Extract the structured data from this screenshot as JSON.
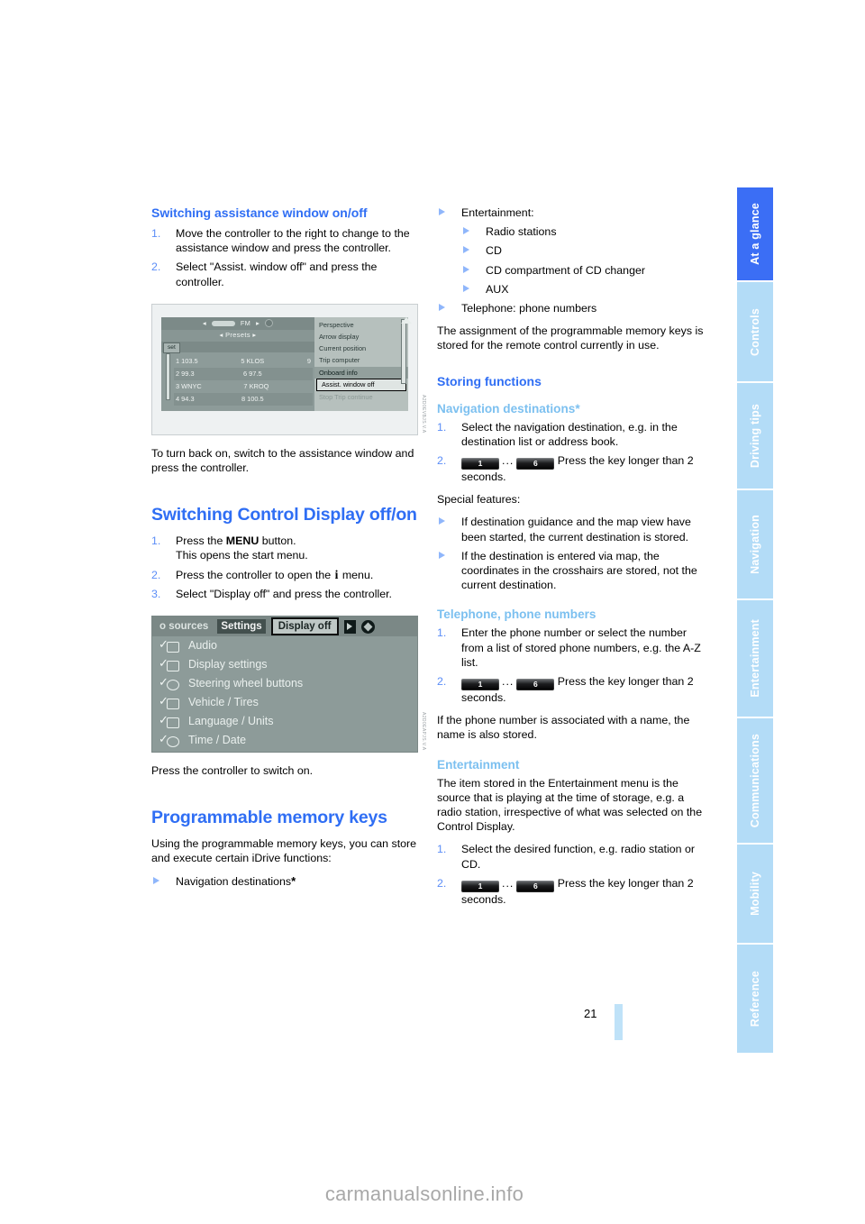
{
  "page_number": "21",
  "watermark": "carmanualsonline.info",
  "colors": {
    "heading_blue": "#2f6ef4",
    "subheading_light_blue": "#7cc0f0",
    "tab_active": "#3b6ef5",
    "tab_inactive": "#b3dcf7",
    "page_bar": "#bfe2f8"
  },
  "side_tabs": [
    {
      "label": "At a glance",
      "active": true
    },
    {
      "label": "Controls",
      "active": false
    },
    {
      "label": "Driving tips",
      "active": false
    },
    {
      "label": "Navigation",
      "active": false
    },
    {
      "label": "Entertainment",
      "active": false
    },
    {
      "label": "Communications",
      "active": false
    },
    {
      "label": "Mobility",
      "active": false
    },
    {
      "label": "Reference",
      "active": false
    }
  ],
  "left_column": {
    "section1": {
      "heading": "Switching assistance window on/off",
      "steps": [
        {
          "num": "1.",
          "text": "Move the controller to the right to change to the assistance window and press the controller."
        },
        {
          "num": "2.",
          "text": "Select \"Assist. window off\" and press the controller."
        }
      ],
      "figure": {
        "ref_code": "A2D0EVBJS.V.A",
        "topbar_label": "FM",
        "presets_label": "Presets",
        "set_button": "set",
        "stations": [
          {
            "left": "1 103.5",
            "mid": "5 KLOS",
            "right": "9"
          },
          {
            "left": "2 99.3",
            "mid": "6 97.5",
            "right": ""
          },
          {
            "left": "3 WNYC",
            "mid": "7 KROQ",
            "right": ""
          },
          {
            "left": "4 94.3",
            "mid": "8 100.5",
            "right": ""
          }
        ],
        "menu_items": [
          {
            "label": "Perspective",
            "state": "normal"
          },
          {
            "label": "Arrow display",
            "state": "normal"
          },
          {
            "label": "Current position",
            "state": "normal"
          },
          {
            "label": "Trip computer",
            "state": "normal"
          },
          {
            "label": "Onboard info",
            "state": "highlight"
          },
          {
            "label": "Assist. window off",
            "state": "selected"
          },
          {
            "label": "Stop Trip continue",
            "state": "dim"
          }
        ]
      },
      "after_figure": "To turn back on, switch to the assistance window and press the controller."
    },
    "section2": {
      "heading": "Switching Control Display off/on",
      "steps": [
        {
          "num": "1.",
          "text_before": "Press the ",
          "bold": "MENU",
          "text_after": " button.",
          "line2": "This opens the start menu."
        },
        {
          "num": "2.",
          "text_before": "Press the controller to open the ",
          "icon": "i",
          "text_after": " menu."
        },
        {
          "num": "3.",
          "text": "Select \"Display off\" and press the controller."
        }
      ],
      "figure": {
        "ref_code": "A2D0EAPJS.V.A",
        "header_tabs": [
          {
            "label": "o sources",
            "style": "plain"
          },
          {
            "label": "Settings",
            "style": "dark"
          },
          {
            "label": "Display off",
            "style": "boxed"
          }
        ],
        "menu_items": [
          "Audio",
          "Display settings",
          "Steering wheel buttons",
          "Vehicle / Tires",
          "Language / Units",
          "Time / Date"
        ]
      },
      "after_figure": "Press the controller to switch on."
    },
    "section3": {
      "heading": "Programmable memory keys",
      "intro": "Using the programmable memory keys, you can store and execute certain iDrive functions:",
      "bullets": [
        {
          "text": "Navigation destinations",
          "star": "*"
        }
      ]
    }
  },
  "right_column": {
    "bullets_top": [
      {
        "text": "Entertainment:",
        "children": [
          "Radio stations",
          "CD",
          "CD compartment of CD changer",
          "AUX"
        ]
      },
      {
        "text": "Telephone: phone numbers",
        "children": []
      }
    ],
    "paragraph_top": "The assignment of the programmable memory keys is stored for the remote control currently in use.",
    "section_heading": "Storing functions",
    "nav": {
      "heading": "Navigation destinations",
      "star": "*",
      "steps": [
        {
          "num": "1.",
          "text": "Select the navigation destination, e.g. in the destination list or address book."
        },
        {
          "num": "2.",
          "key_from": "1",
          "key_dots": "...",
          "key_to": "6",
          "text": "Press the key longer than 2 seconds."
        }
      ],
      "special_label": "Special features:",
      "special": [
        "If destination guidance and the map view have been started, the current destination is stored.",
        "If the destination is entered via map, the coordinates in the crosshairs are stored, not the current destination."
      ]
    },
    "telephone": {
      "heading": "Telephone, phone numbers",
      "steps": [
        {
          "num": "1.",
          "text": "Enter the phone number or select the number from a list of stored phone numbers, e.g. the A-Z list."
        },
        {
          "num": "2.",
          "key_from": "1",
          "key_dots": "...",
          "key_to": "6",
          "text": "Press the key longer than 2 seconds."
        }
      ],
      "note": "If the phone number is associated with a name, the name is also stored."
    },
    "entertainment": {
      "heading": "Entertainment",
      "intro": "The item stored in the Entertainment menu is the source that is playing at the time of storage, e.g. a radio station, irrespective of what was selected on the Control Display.",
      "steps": [
        {
          "num": "1.",
          "text": "Select the desired function, e.g. radio station or CD."
        },
        {
          "num": "2.",
          "key_from": "1",
          "key_dots": "...",
          "key_to": "6",
          "text": "Press the key longer than 2 seconds."
        }
      ]
    }
  }
}
